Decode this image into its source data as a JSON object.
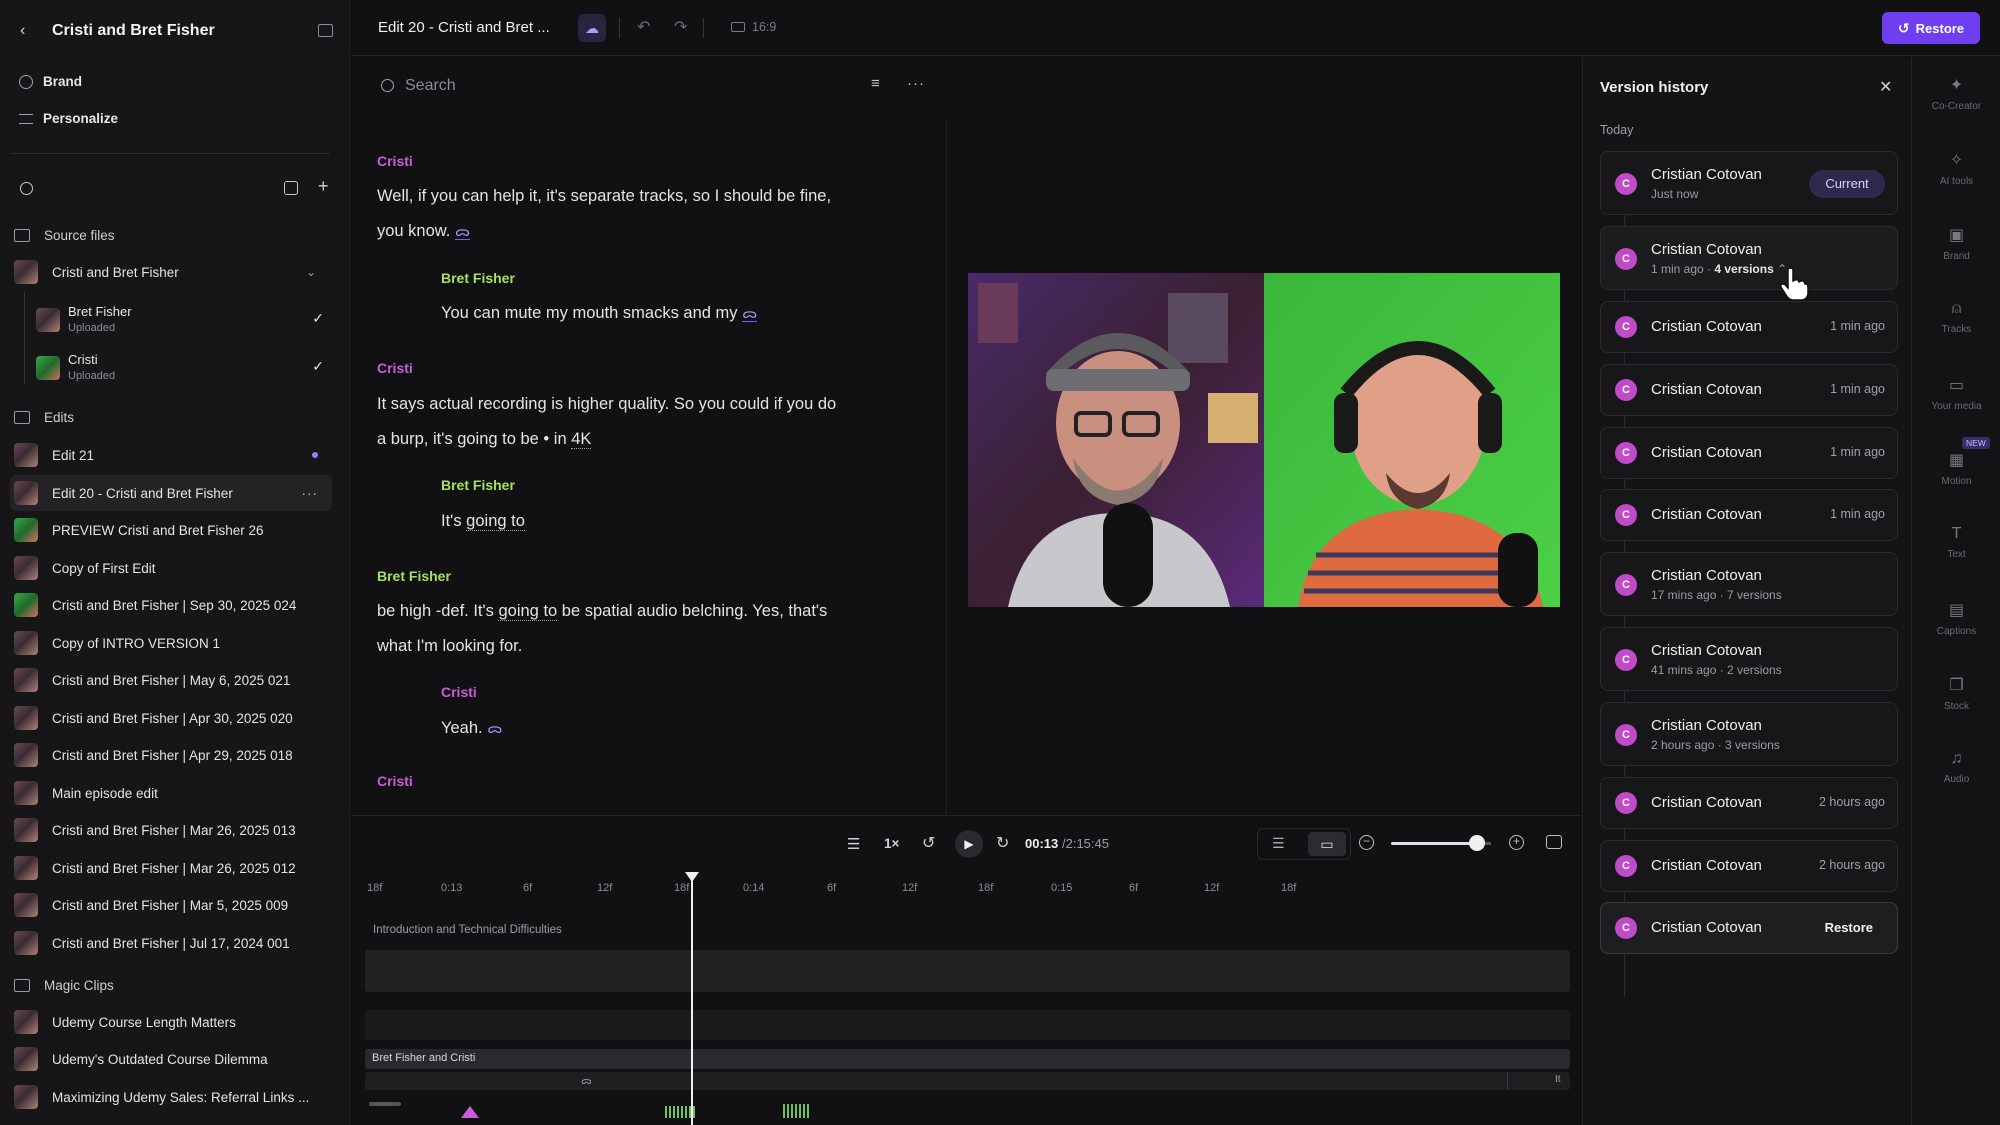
{
  "sidebar": {
    "project_title": "Cristi and Bret Fisher",
    "nav": [
      {
        "label": "Brand"
      },
      {
        "label": "Personalize"
      }
    ],
    "source_files_label": "Source files",
    "source_group": "Cristi and Bret Fisher",
    "sources": [
      {
        "name": "Bret Fisher",
        "status": "Uploaded"
      },
      {
        "name": "Cristi",
        "status": "Uploaded"
      }
    ],
    "edits_label": "Edits",
    "edits": [
      "Edit 21",
      "Edit 20 - Cristi and Bret Fisher",
      "PREVIEW Cristi and Bret Fisher 26",
      "Copy of First Edit",
      "Cristi and Bret Fisher | Sep 30, 2025 024",
      "Copy of INTRO VERSION 1",
      "Cristi and Bret Fisher | May 6, 2025 021",
      "Cristi and Bret Fisher | Apr 30, 2025 020",
      "Cristi and Bret Fisher | Apr 29, 2025 018",
      "Main episode edit",
      "Cristi and Bret Fisher | Mar 26, 2025 013",
      "Cristi and Bret Fisher | Mar 26, 2025 012",
      "Cristi and Bret Fisher | Mar 5, 2025 009",
      "Cristi and Bret Fisher | Jul 17, 2024 001"
    ],
    "magic_label": "Magic Clips",
    "magic_clips": [
      "Udemy Course Length Matters",
      "Udemy's Outdated Course Dilemma",
      "Maximizing Udemy Sales: Referral Links ..."
    ]
  },
  "topbar": {
    "title": "Edit 20 - Cristi and Bret ...",
    "aspect": "16:9",
    "restore_label": "Restore"
  },
  "transcript": {
    "search_placeholder": "Search",
    "blocks": [
      {
        "speaker": "Cristi",
        "l1": "Well, if you can help it, it's separate tracks, so I should be fine,",
        "l2": "you know."
      },
      {
        "speaker": "Bret Fisher",
        "l1": "You can mute my mouth smacks and my"
      },
      {
        "speaker": "Cristi",
        "l1": "It says actual recording is higher quality. So you could if you do",
        "l2": "a burp, it's going to be • in",
        "l2b": "4K"
      },
      {
        "speaker": "Bret Fisher",
        "l1": "It's",
        "l1b": "going to"
      },
      {
        "speaker": "Bret Fisher",
        "l1": "be high -def. It's",
        "l1b": "going to",
        "l1c": "be spatial audio belching. Yes, that's",
        "l2": "what I'm looking for."
      },
      {
        "speaker": "Cristi",
        "l1": "Yeah."
      },
      {
        "speaker": "Cristi"
      }
    ]
  },
  "timeline": {
    "speed": "1×",
    "current": "00:13",
    "total": "/2:15:45",
    "ruler": [
      "18f",
      "0:13",
      "6f",
      "12f",
      "18f",
      "0:14",
      "6f",
      "12f",
      "18f",
      "0:15",
      "6f",
      "12f",
      "18f"
    ],
    "chapter": "Introduction and Technical Difficulties",
    "track_label": "Bret Fisher and Cristi",
    "track_end": "It"
  },
  "version_history": {
    "title": "Version history",
    "section": "Today",
    "current_label": "Current",
    "restore_label": "Restore",
    "versions": [
      {
        "name": "Cristian Cotovan",
        "meta": "Just now"
      },
      {
        "name": "Cristian Cotovan",
        "meta": "1 min ago · ",
        "meta_b": "4 versions"
      },
      {
        "name": "Cristian Cotovan",
        "time": "1 min ago"
      },
      {
        "name": "Cristian Cotovan",
        "time": "1 min ago"
      },
      {
        "name": "Cristian Cotovan",
        "time": "1 min ago"
      },
      {
        "name": "Cristian Cotovan",
        "time": "1 min ago"
      },
      {
        "name": "Cristian Cotovan",
        "meta": "17 mins ago · 7 versions"
      },
      {
        "name": "Cristian Cotovan",
        "meta": "41 mins ago · 2 versions"
      },
      {
        "name": "Cristian Cotovan",
        "meta": "2 hours ago · 3 versions"
      },
      {
        "name": "Cristian Cotovan",
        "time": "2 hours ago"
      },
      {
        "name": "Cristian Cotovan",
        "time": "2 hours ago"
      },
      {
        "name": "Cristian Cotovan"
      }
    ],
    "avatar_letter": "C"
  },
  "rail": {
    "items": [
      "Co-Creator",
      "AI tools",
      "Brand",
      "Tracks",
      "Your media",
      "Motion",
      "Text",
      "Captions",
      "Stock",
      "Audio"
    ],
    "new_badge": "NEW"
  },
  "colors": {
    "accent": "#6e3ef0",
    "speaker_cristi": "#c95fd8",
    "speaker_bret": "#a7e05c",
    "avatar": "#c04ac8"
  }
}
